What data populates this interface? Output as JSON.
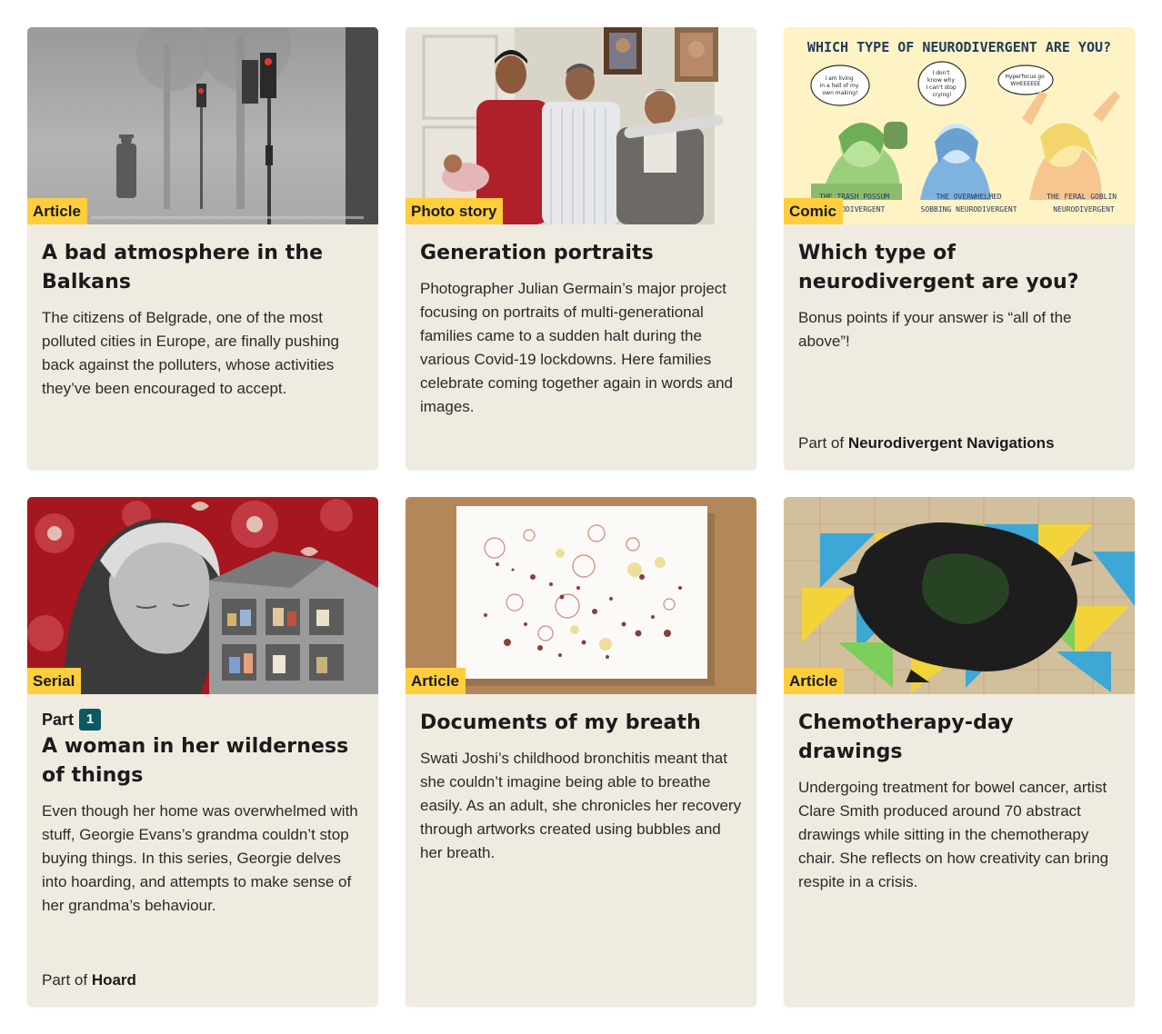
{
  "cards": [
    {
      "label": "Article",
      "title": "A bad atmosphere in the Balkans",
      "description": "The citizens of Belgrade, one of the most polluted cities in Europe, are finally pushing back against the polluters, whose activities they’ve been encouraged to accept."
    },
    {
      "label": "Photo story",
      "title": "Generation portraits",
      "description": "Photographer Julian Germain’s major project focusing on portraits of multi-generational families came to a sudden halt during the various Covid-19 lockdowns. Here families celebrate coming together again in words and images."
    },
    {
      "label": "Comic",
      "title": "Which type of neurodivergent are you?",
      "description": "Bonus points if your answer is “all of the above”!",
      "series_prefix": "Part of ",
      "series_name": "Neurodivergent Navigations",
      "comic": {
        "heading": "WHICH TYPE OF NEURODIVERGENT ARE YOU?",
        "bubble1": [
          "I am living",
          "in a hell of my",
          "own making!"
        ],
        "bubble2": [
          "I don't",
          "know why",
          "I can't stop",
          "crying!"
        ],
        "bubble3": [
          "Hyperfocus go",
          "WHEEEEEE"
        ],
        "caption1": [
          "THE TRASH POSSUM",
          "NEURODIVERGENT"
        ],
        "caption2": [
          "THE OVERWHELMED",
          "SOBBING NEURODIVERGENT"
        ],
        "caption3": [
          "THE FERAL GOBLIN",
          "NEURODIVERGENT"
        ]
      }
    },
    {
      "label": "Serial",
      "part_label": "Part",
      "part_number": "1",
      "title": "A woman in her wilderness of things",
      "description": "Even though her home was overwhelmed with stuff, Georgie Evans’s grandma couldn’t stop buying things. In this series, Georgie delves into hoarding, and attempts to make sense of her grandma’s behaviour.",
      "series_prefix": "Part of ",
      "series_name": "Hoard"
    },
    {
      "label": "Article",
      "title": "Documents of my breath",
      "description": "Swati Joshi’s childhood bronchitis meant that she couldn’t imagine being able to breathe easily. As an adult, she chronicles her recovery through artworks created using bubbles and her breath."
    },
    {
      "label": "Article",
      "title": "Chemotherapy-day drawings",
      "description": "Undergoing treatment for bowel cancer, artist Clare Smith produced around 70 abstract drawings while sitting in the chemotherapy chair. She reflects on how creativity can bring respite in a crisis."
    }
  ],
  "colors": {
    "card_bg": "#efebe1",
    "label_bg": "#ffce3c",
    "part_badge": "#0b5a63"
  }
}
